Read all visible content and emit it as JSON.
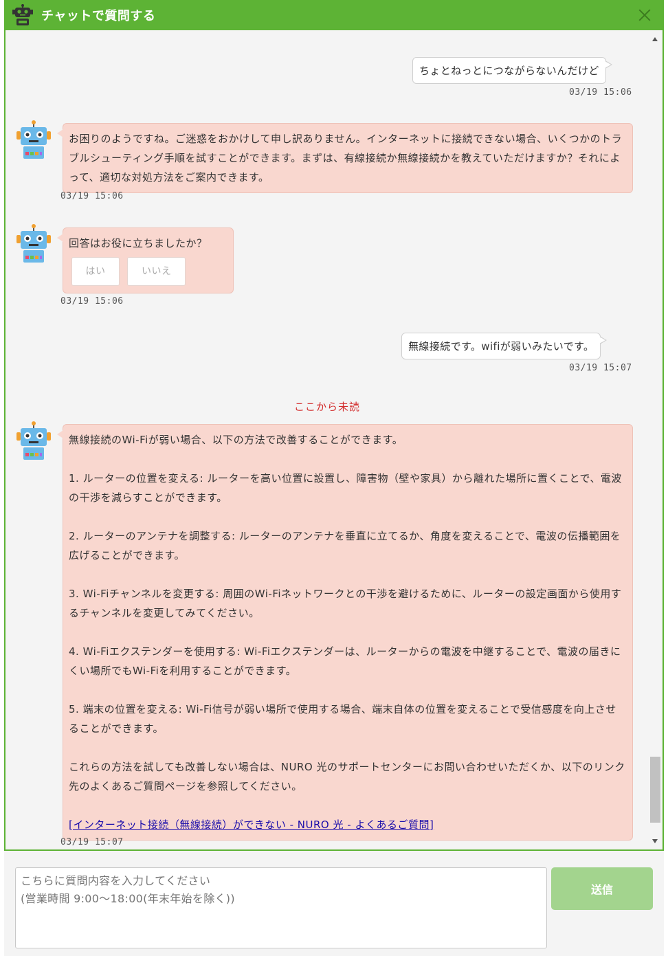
{
  "header": {
    "title": "チャットで質問する",
    "close_icon": "close-icon"
  },
  "messages": {
    "user1": {
      "text": "ちょとねっとにつながらないんだけど",
      "time": "03/19 15:06"
    },
    "bot1": {
      "text": "お困りのようですね。ご迷惑をおかけして申し訳ありません。インターネットに接続できない場合、いくつかのトラブルシューティング手順を試すことができます。まずは、有線接続か無線接続かを教えていただけますか？それによって、適切な対処方法をご案内できます。",
      "time": "03/19 15:06"
    },
    "bot2": {
      "text": "回答はお役に立ちましたか？",
      "yes": "はい",
      "no": "いいえ",
      "time": "03/19 15:06"
    },
    "user2": {
      "text": "無線接続です。wifiが弱いみたいです。",
      "time": "03/19 15:07"
    },
    "unread_divider": "ここから未読",
    "bot3": {
      "paragraphs": [
        "無線接続のWi-Fiが弱い場合、以下の方法で改善することができます。",
        "1. ルーターの位置を変える: ルーターを高い位置に設置し、障害物（壁や家具）から離れた場所に置くことで、電波の干渉を減らすことができます。",
        "2. ルーターのアンテナを調整する: ルーターのアンテナを垂直に立てるか、角度を変えることで、電波の伝播範囲を広げることができます。",
        "3. Wi-Fiチャンネルを変更する: 周囲のWi-Fiネットワークとの干渉を避けるために、ルーターの設定画面から使用するチャンネルを変更してみてください。",
        "4. Wi-Fiエクステンダーを使用する: Wi-Fiエクステンダーは、ルーターからの電波を中継することで、電波の届きにくい場所でもWi-Fiを利用することができます。",
        "5. 端末の位置を変える: Wi-Fi信号が弱い場所で使用する場合、端末自体の位置を変えることで受信感度を向上させることができます。",
        "これらの方法を試しても改善しない場合は、NURO 光のサポートセンターにお問い合わせいただくか、以下のリンク先のよくあるご質問ページを参照してください。"
      ],
      "link": "[インターネット接続（無線接続）ができない - NURO 光 - よくあるご質問]",
      "time": "03/19 15:07"
    }
  },
  "input": {
    "placeholder": "こちらに質問内容を入力してください\n(営業時間 9:00～18:00(年末年始を除く))"
  },
  "send_label": "送信",
  "colors": {
    "brand_green": "#5db335",
    "bot_bubble": "#f9d7cf",
    "send_button": "#a3d48e",
    "unread_red": "#d22b2b"
  }
}
